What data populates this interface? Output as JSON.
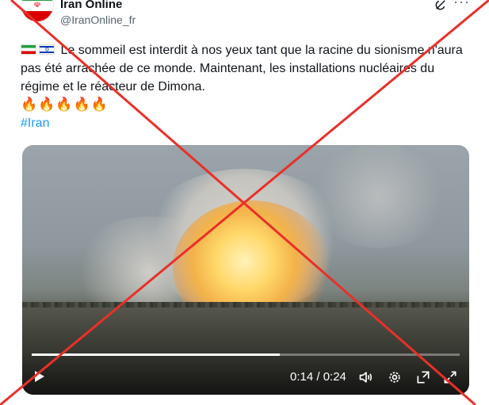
{
  "account": {
    "name": "Iran Online",
    "handle": "@IranOnline_fr"
  },
  "tweet": {
    "text": "Le sommeil est interdit à nos yeux tant que la racine du sionisme n'aura pas été arrachée de ce monde. Maintenant, les installations nucléaires du régime et le réacteur de Dimona.",
    "flags": [
      "iran-flag",
      "israel-flag"
    ],
    "fire_emojis": "🔥🔥🔥🔥🔥",
    "hashtag": "#Iran"
  },
  "video": {
    "current_time": "0:14",
    "duration": "0:24",
    "time_display": "0:14 / 0:24",
    "progress_fraction": 0.58
  },
  "icons": [
    "grok-icon",
    "more-icon",
    "play-icon",
    "volume-icon",
    "settings-icon",
    "expand-icon",
    "fullscreen-icon"
  ],
  "overlay": {
    "cross_color": "#e8302a"
  }
}
